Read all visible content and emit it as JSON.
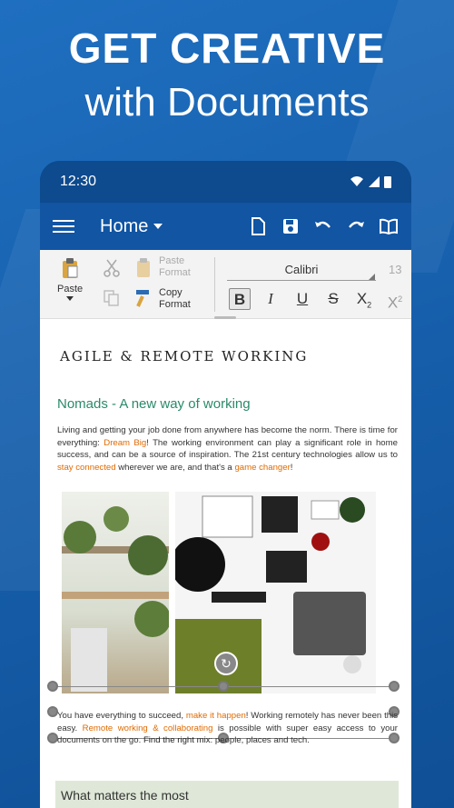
{
  "headline": {
    "line1": "GET CREATIVE",
    "line2": "with Documents"
  },
  "status": {
    "time": "12:30",
    "icons": [
      "wifi-icon",
      "signal-icon",
      "battery-icon"
    ]
  },
  "appbar": {
    "title": "Home",
    "actions": [
      "new-file-icon",
      "save-icon",
      "undo-icon",
      "redo-icon",
      "book-icon"
    ]
  },
  "ribbon": {
    "paste": "Paste",
    "paste_format_1": "Paste",
    "paste_format_2": "Format",
    "copy_format_1": "Copy",
    "copy_format_2": "Format",
    "font": "Calibri",
    "font_size": "13",
    "bold": "B",
    "italic": "I",
    "underline": "U",
    "strike": "S",
    "subscript_base": "X",
    "subscript_mark": "2",
    "superscript_base": "X",
    "superscript_mark": "2"
  },
  "document": {
    "title": "AGILE & REMOTE WORKING",
    "subtitle": "Nomads - A new way of working",
    "para1": {
      "a": "Living and getting your job done from anywhere has become the norm. There is time for everything: ",
      "b": "Dream Big",
      "c": "! The working environment can play a significant role in home success, and can be a source of inspiration. The 21st century technologies allow us to ",
      "d": "stay connected",
      "e": " wherever we are, and that's a ",
      "f": "game changer",
      "g": "!"
    },
    "para2": {
      "a": "You have everything to succeed, ",
      "b": "make it happen",
      "c": "! Working remotely has never been this easy. ",
      "d": "Remote working & collaborating",
      "e": " is possible with super easy access to your documents on the go. ",
      "f": "Find the right mix",
      "g": ": people, places and tech."
    },
    "section_heading": "What matters the most"
  },
  "colors": {
    "brand_blue": "#1155a3",
    "accent_orange": "#e06a00",
    "subtitle_green": "#2a8a6a"
  }
}
